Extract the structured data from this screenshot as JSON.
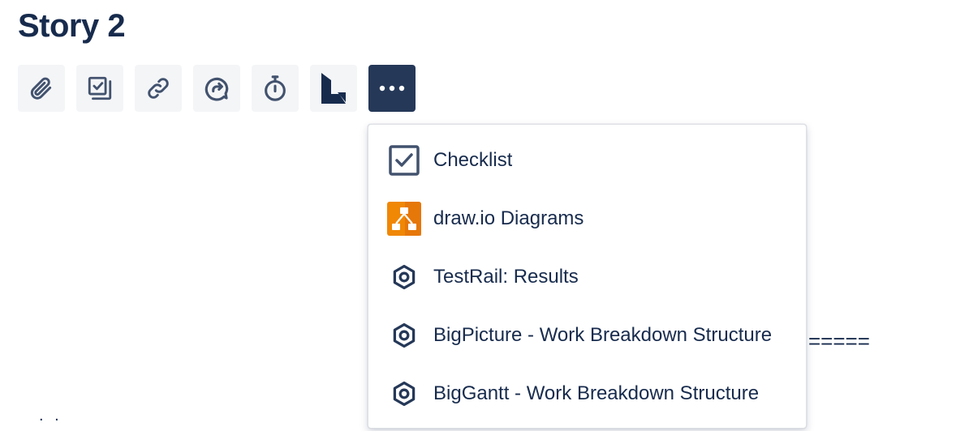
{
  "issue": {
    "title": "Story 2"
  },
  "toolbar": {
    "buttons": [
      {
        "icon": "paperclip-icon",
        "label": "Attach"
      },
      {
        "icon": "checklist-stack-icon",
        "label": "Add child issue"
      },
      {
        "icon": "link-icon",
        "label": "Link issue"
      },
      {
        "icon": "share-chat-icon",
        "label": "Share"
      },
      {
        "icon": "stopwatch-icon",
        "label": "Log time"
      },
      {
        "icon": "app-logo-icon",
        "label": "App"
      },
      {
        "icon": "more-icon",
        "label": "More"
      }
    ],
    "active_color": "#253858"
  },
  "dropdown": {
    "items": [
      {
        "label": "Checklist",
        "icon": "checkbox-icon"
      },
      {
        "label": "draw.io Diagrams",
        "icon": "drawio-icon",
        "color": "#f08705"
      },
      {
        "label": "TestRail: Results",
        "icon": "hexagon-icon"
      },
      {
        "label": "BigPicture - Work Breakdown Structure",
        "icon": "hexagon-icon"
      },
      {
        "label": "BigGantt - Work Breakdown Structure",
        "icon": "hexagon-icon"
      }
    ]
  },
  "background_fragments": {
    "equals_run": "=====",
    "dots": ". ."
  }
}
